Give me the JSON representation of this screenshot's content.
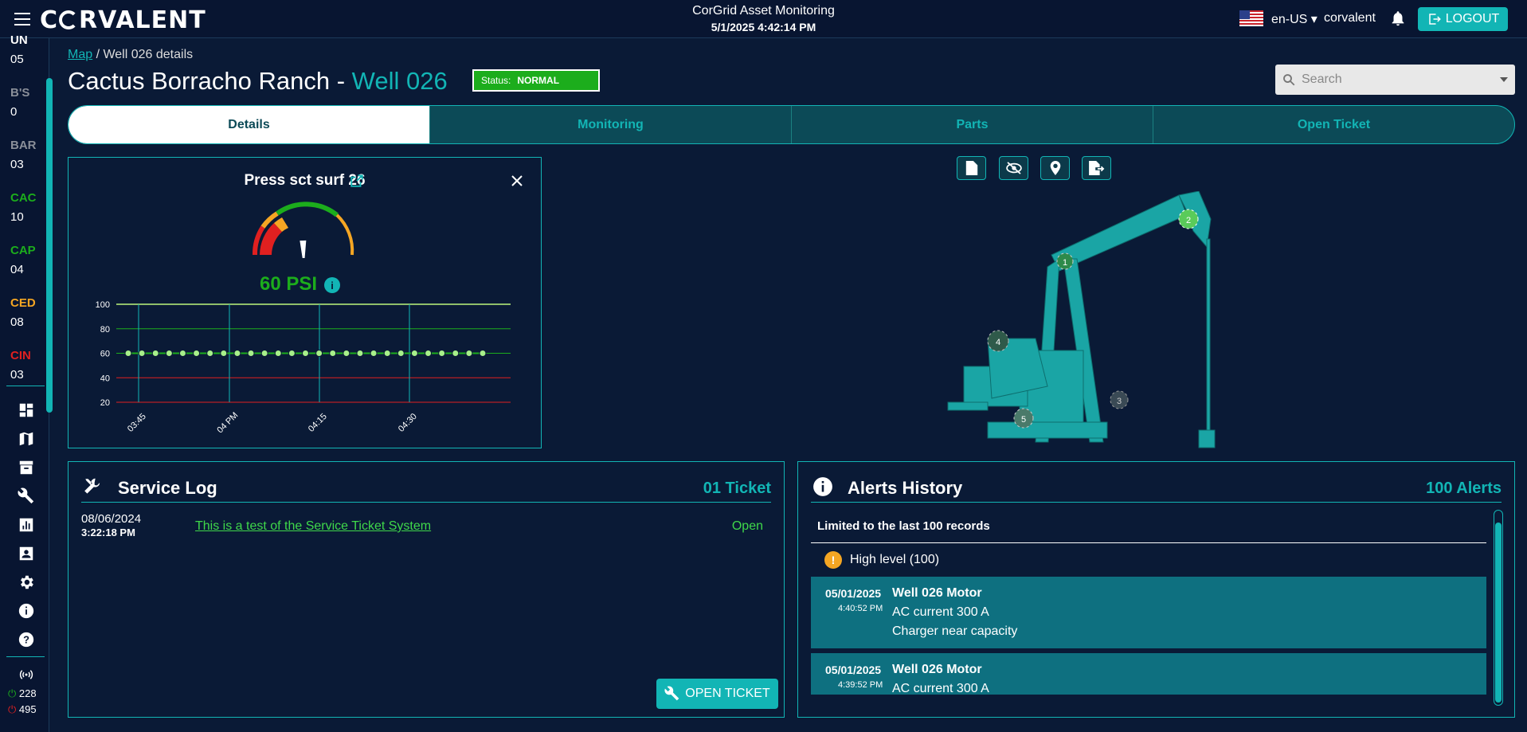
{
  "topbar": {
    "logo": "CORVALENT",
    "app_title": "CorGrid Asset Monitoring",
    "datetime": "5/1/2025 4:42:14 PM",
    "language": "en-US",
    "user": "corvalent",
    "logout_label": "LOGOUT"
  },
  "sidebar": {
    "items": [
      {
        "code": "UN",
        "count": "05",
        "color": "#ffffff"
      },
      {
        "code": "B'S",
        "count": "0",
        "color": "#8a8f99"
      },
      {
        "code": "BAR",
        "count": "03",
        "color": "#8a8f99"
      },
      {
        "code": "CAC",
        "count": "10",
        "color": "#1cad1c"
      },
      {
        "code": "CAP",
        "count": "04",
        "color": "#1cad1c"
      },
      {
        "code": "CED",
        "count": "08",
        "color": "#f5a623"
      },
      {
        "code": "CIN",
        "count": "03",
        "color": "#e02020"
      }
    ],
    "online_count": "228",
    "offline_count": "495"
  },
  "breadcrumb": {
    "root": "Map",
    "current": "Well 026 details"
  },
  "header": {
    "title_prefix": "Cactus Borracho Ranch - ",
    "title_well": "Well 026",
    "status_label": "Status:",
    "status_value": "NORMAL"
  },
  "search": {
    "placeholder": "Search"
  },
  "tabs": [
    "Details",
    "Monitoring",
    "Parts",
    "Open Ticket"
  ],
  "gauge": {
    "title": "Press sct surf 26",
    "value": "60 PSI",
    "needle_value": 60,
    "range": [
      0,
      100
    ]
  },
  "chart_data": {
    "type": "line",
    "x_ticks": [
      "03:45",
      "04 PM",
      "04:15",
      "04:30"
    ],
    "y_ticks": [
      20,
      40,
      60,
      80,
      100
    ],
    "ylim": [
      20,
      100
    ],
    "series": [
      {
        "values": [
          60,
          60,
          60,
          60,
          60,
          60,
          60,
          60,
          60,
          60,
          60,
          60,
          60,
          60,
          60,
          60,
          60,
          60,
          60,
          60,
          60,
          60,
          60,
          60,
          60,
          60,
          60
        ]
      }
    ],
    "thresholds": {
      "high": 80,
      "low": 40
    },
    "colors": {
      "line": "#1cad1c",
      "point": "#a8f08a",
      "low": "#e02020",
      "high": "#1cad1c"
    }
  },
  "pump": {
    "markers": [
      "1",
      "2",
      "3",
      "4",
      "5"
    ]
  },
  "service_log": {
    "title": "Service Log",
    "count": "01 Ticket",
    "entries": [
      {
        "date": "08/06/2024",
        "time": "3:22:18 PM",
        "description": "This is a test of the Service Ticket System",
        "status": "Open"
      }
    ],
    "button": "OPEN TICKET"
  },
  "alerts": {
    "title": "Alerts History",
    "count": "100 Alerts",
    "limit_note": "Limited to the last 100 records",
    "level": "High level (100)",
    "rows": [
      {
        "date": "05/01/2025",
        "time": "4:40:52 PM",
        "name": "Well 026 Motor",
        "line1": "AC current 300 A",
        "line2": "Charger near capacity"
      },
      {
        "date": "05/01/2025",
        "time": "4:39:52 PM",
        "name": "Well 026 Motor",
        "line1": "AC current 300 A",
        "line2": ""
      }
    ]
  },
  "colors": {
    "accent": "#12b5b5",
    "background": "#0a1a36",
    "status_normal": "#1cad1c"
  }
}
